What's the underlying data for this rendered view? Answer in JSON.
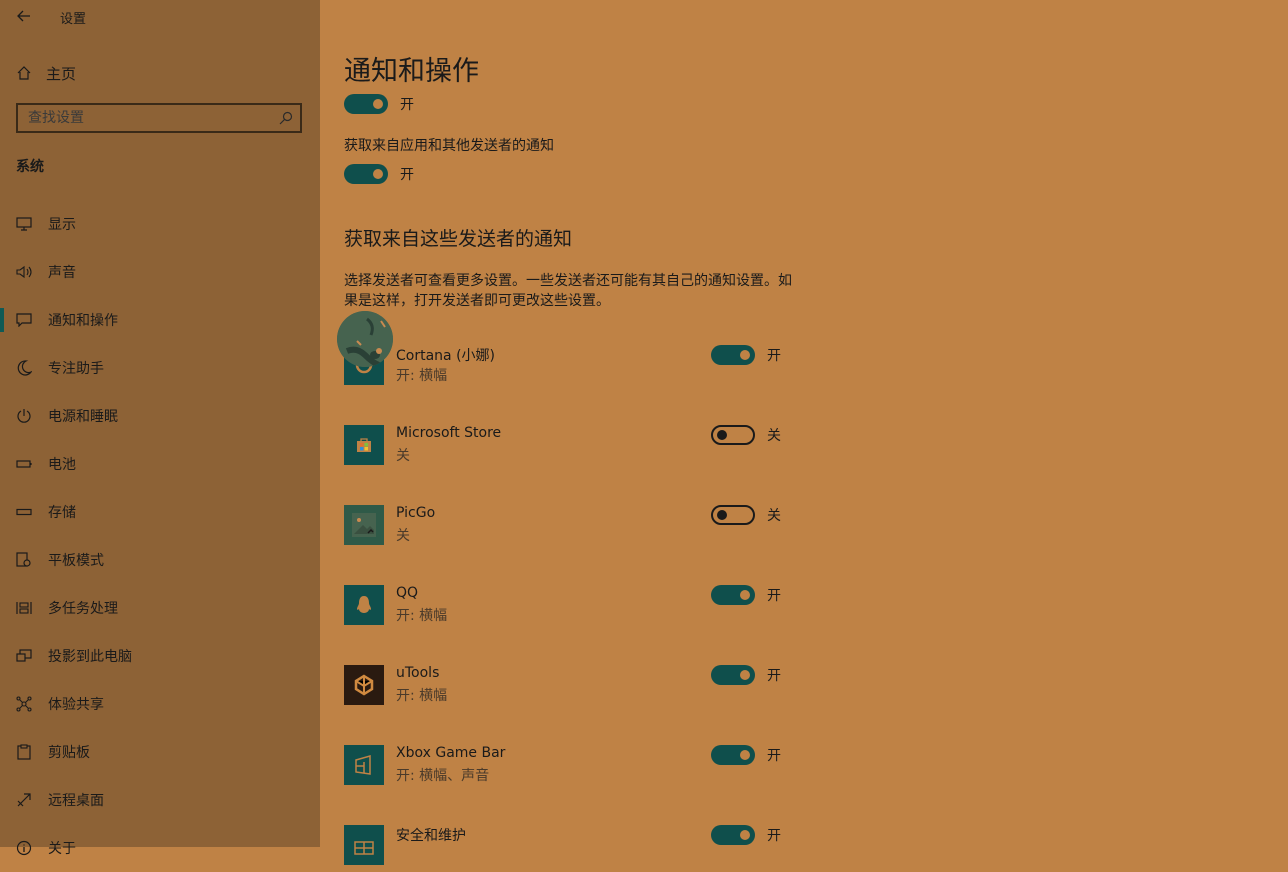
{
  "window": {
    "title": "设置",
    "back_label": "←"
  },
  "sidebar": {
    "home_label": "主页",
    "search_placeholder": "查找设置",
    "section_label": "系统",
    "items": [
      {
        "label": "显示",
        "icon": "monitor-icon"
      },
      {
        "label": "声音",
        "icon": "speaker-icon"
      },
      {
        "label": "通知和操作",
        "icon": "notification-icon",
        "active": true
      },
      {
        "label": "专注助手",
        "icon": "moon-icon"
      },
      {
        "label": "电源和睡眠",
        "icon": "power-icon"
      },
      {
        "label": "电池",
        "icon": "battery-icon"
      },
      {
        "label": "存储",
        "icon": "storage-icon"
      },
      {
        "label": "平板模式",
        "icon": "tablet-icon"
      },
      {
        "label": "多任务处理",
        "icon": "multitask-icon"
      },
      {
        "label": "投影到此电脑",
        "icon": "project-icon"
      },
      {
        "label": "体验共享",
        "icon": "share-icon"
      },
      {
        "label": "剪贴板",
        "icon": "clipboard-icon"
      },
      {
        "label": "远程桌面",
        "icon": "remote-icon"
      },
      {
        "label": "关于",
        "icon": "info-icon"
      }
    ]
  },
  "main": {
    "title": "通知和操作",
    "top_toggle": {
      "state": "开",
      "on": true
    },
    "get_notifications_label": "获取来自应用和其他发送者的通知",
    "get_notifications_toggle": {
      "state": "开",
      "on": true
    },
    "senders_heading": "获取来自这些发送者的通知",
    "senders_desc": "选择发送者可查看更多设置。一些发送者还可能有其自己的通知设置。如果是这样，打开发送者即可更改这些设置。",
    "apps": [
      {
        "name": "Cortana (小娜)",
        "sub": "开: 横幅",
        "state": "开",
        "on": true,
        "icon": "cortana-icon"
      },
      {
        "name": "Microsoft Store",
        "sub": "关",
        "state": "关",
        "on": false,
        "icon": "store-icon"
      },
      {
        "name": "PicGo",
        "sub": "关",
        "state": "关",
        "on": false,
        "icon": "picgo-icon"
      },
      {
        "name": "QQ",
        "sub": "开: 横幅",
        "state": "开",
        "on": true,
        "icon": "qq-penguin-icon"
      },
      {
        "name": "uTools",
        "sub": "开: 横幅",
        "state": "开",
        "on": true,
        "icon": "utools-icon"
      },
      {
        "name": "Xbox Game Bar",
        "sub": "开: 横幅、声音",
        "state": "开",
        "on": true,
        "icon": "xbox-game-bar-icon"
      },
      {
        "name": "安全和维护",
        "sub": "",
        "state": "开",
        "on": true,
        "icon": "security-icon"
      }
    ]
  },
  "colors": {
    "background": "#bf8245",
    "sidebar": "#8d6236",
    "accent": "#0f4f4c"
  }
}
